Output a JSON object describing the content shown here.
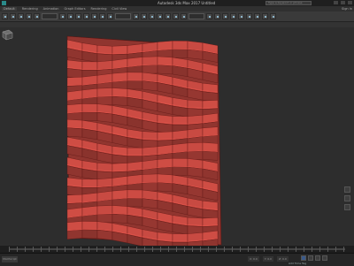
{
  "titlebar": {
    "title": "Autodesk 3ds Max 2017   Untitled",
    "search_placeholder": "Type a keyword or phrase"
  },
  "menubar": {
    "workspace": "Default",
    "items": [
      "Rendering",
      "Animation",
      "Graph Editors",
      "Rendering",
      "Civil View"
    ],
    "signin": "Sign In"
  },
  "statusbar": {
    "maxscript": "MAXScript",
    "coord_x": "X: 0.0",
    "coord_y": "Y: 0.0",
    "coord_z": "Z: 0.0",
    "add_time_tag": "Add Time Tag"
  },
  "colors": {
    "viewport_bg": "#2d2d2d",
    "mesh_face": "#c0473f",
    "mesh_edge": "#5a1512"
  },
  "icons": [
    "app-icon",
    "viewcube-icon",
    "pan-icon",
    "orbit-icon",
    "zoom-icon",
    "set-key-icon"
  ]
}
